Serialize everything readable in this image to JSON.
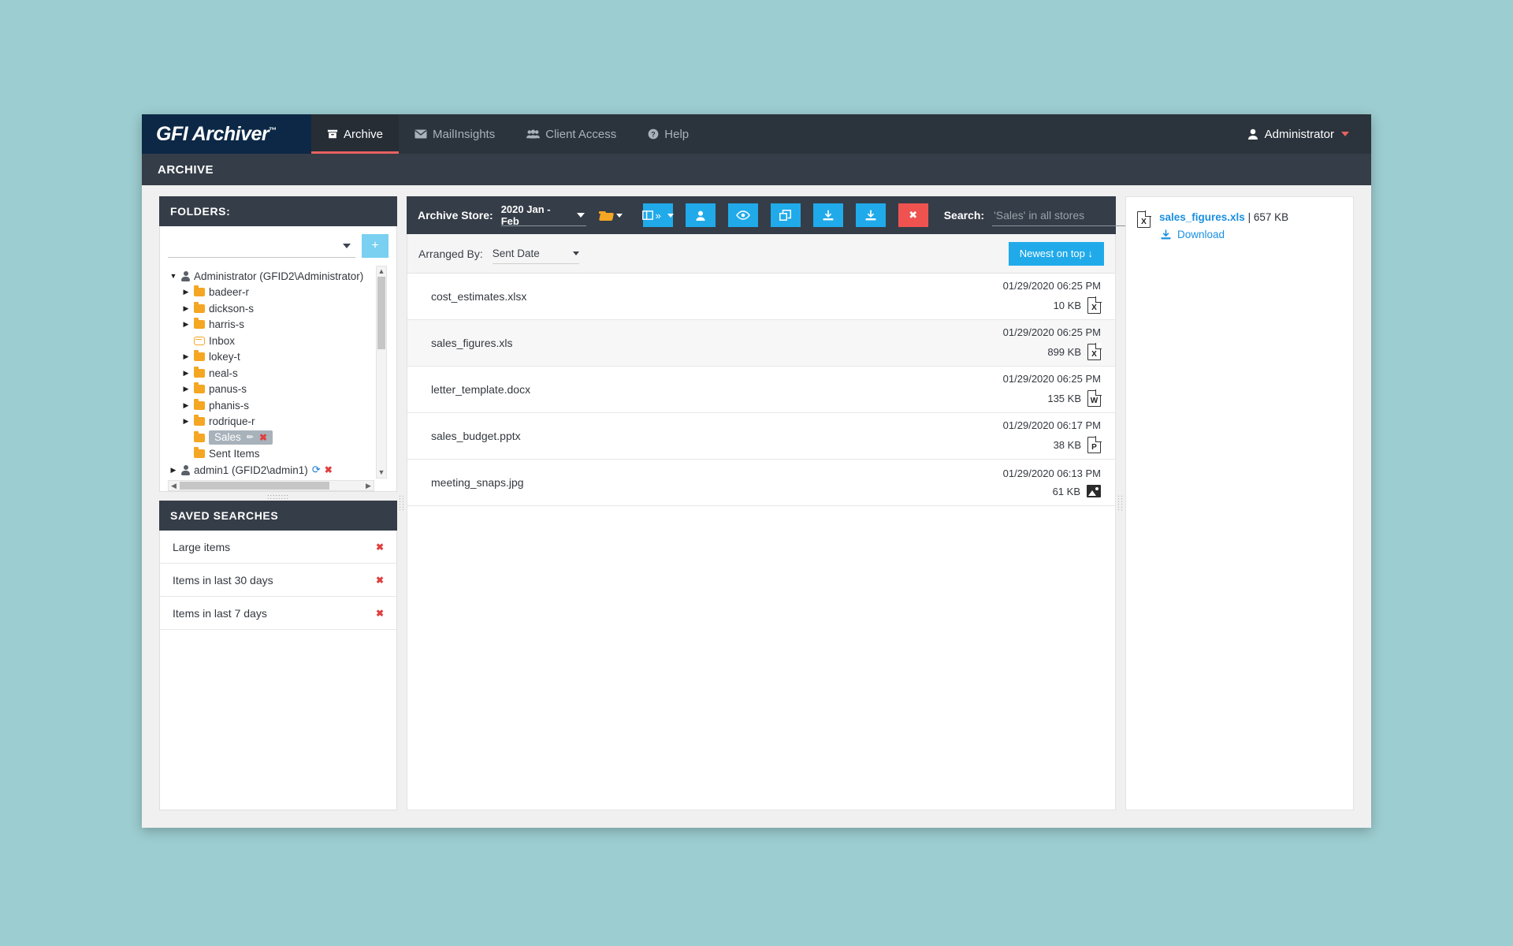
{
  "app": {
    "logo_primary": "GFI",
    "logo_secondary": "Archiver",
    "logo_tm": "™"
  },
  "topnav": {
    "items": [
      {
        "label": "Archive",
        "icon": "archive-box-icon",
        "active": true
      },
      {
        "label": "MailInsights",
        "icon": "envelope-icon",
        "active": false
      },
      {
        "label": "Client Access",
        "icon": "users-icon",
        "active": false
      },
      {
        "label": "Help",
        "icon": "question-circle-icon",
        "active": false
      }
    ],
    "user": {
      "label": "Administrator",
      "icon": "user-icon"
    }
  },
  "breadcrumb": {
    "title": "ARCHIVE"
  },
  "folders_panel": {
    "header": "FOLDERS:",
    "select_value": "",
    "add_button_label": "+",
    "tree": [
      {
        "label": "Administrator (GFID2\\Administrator)",
        "kind": "user",
        "depth": 0,
        "expanded": true,
        "toggle": "▼"
      },
      {
        "label": "badeer-r",
        "kind": "folder",
        "depth": 1,
        "toggle": "▶"
      },
      {
        "label": "dickson-s",
        "kind": "folder",
        "depth": 1,
        "toggle": "▶"
      },
      {
        "label": "harris-s",
        "kind": "folder",
        "depth": 1,
        "toggle": "▶"
      },
      {
        "label": "Inbox",
        "kind": "inbox",
        "depth": 1,
        "toggle": ""
      },
      {
        "label": "lokey-t",
        "kind": "folder",
        "depth": 1,
        "toggle": "▶"
      },
      {
        "label": "neal-s",
        "kind": "folder",
        "depth": 1,
        "toggle": "▶"
      },
      {
        "label": "panus-s",
        "kind": "folder",
        "depth": 1,
        "toggle": "▶"
      },
      {
        "label": "phanis-s",
        "kind": "folder",
        "depth": 1,
        "toggle": "▶"
      },
      {
        "label": "rodrique-r",
        "kind": "folder",
        "depth": 1,
        "toggle": "▶"
      },
      {
        "label": "Sales",
        "kind": "folder",
        "depth": 1,
        "toggle": "",
        "selected": true
      },
      {
        "label": "Sent Items",
        "kind": "folder",
        "depth": 1,
        "toggle": ""
      },
      {
        "label": "admin1 (GFID2\\admin1)",
        "kind": "user",
        "depth": 0,
        "toggle": "▶"
      }
    ],
    "selected_actions": {
      "edit": "✏",
      "delete": "✖"
    },
    "account_actions": {
      "refresh": "⟳",
      "delete": "✖"
    }
  },
  "saved_searches": {
    "header": "SAVED SEARCHES",
    "items": [
      {
        "label": "Large items",
        "delete": "✖"
      },
      {
        "label": "Items in last 30 days",
        "delete": "✖"
      },
      {
        "label": "Items in last 7 days",
        "delete": "✖"
      }
    ]
  },
  "toolbar": {
    "store_label": "Archive Store:",
    "store_value": "2020 Jan - Feb",
    "folder_picker_icon": "open-folder-icon",
    "buttons": [
      {
        "name": "view-layout-button",
        "icon": "columns-icon",
        "glyph": "»",
        "has_caret": true,
        "style": "primary"
      },
      {
        "name": "assign-user-button",
        "icon": "user-icon",
        "glyph": "",
        "has_caret": false,
        "style": "primary"
      },
      {
        "name": "mark-read-button",
        "icon": "eye-icon",
        "glyph": "",
        "has_caret": false,
        "style": "primary"
      },
      {
        "name": "copy-button",
        "icon": "copy-icon",
        "glyph": "",
        "has_caret": false,
        "style": "primary"
      },
      {
        "name": "download-button",
        "icon": "download-icon",
        "glyph": "",
        "has_caret": false,
        "style": "primary"
      },
      {
        "name": "export-button",
        "icon": "download-icon",
        "glyph": "",
        "has_caret": false,
        "style": "primary"
      },
      {
        "name": "delete-button",
        "icon": "close-icon",
        "glyph": "✖",
        "has_caret": false,
        "style": "danger"
      }
    ],
    "search_label": "Search:",
    "search_value": "",
    "search_placeholder": "'Sales' in all stores",
    "search_button_icon": "search-icon",
    "search_options_icon": "chevron-down-icon"
  },
  "arrange_bar": {
    "label": "Arranged By:",
    "value": "Sent Date",
    "sort_button": "Newest on top ↓"
  },
  "file_list": {
    "rows": [
      {
        "name": "cost_estimates.xlsx",
        "date": "01/29/2020 06:25 PM",
        "size": "10 KB",
        "type": "excel",
        "letter": "X"
      },
      {
        "name": "sales_figures.xls",
        "date": "01/29/2020 06:25 PM",
        "size": "899 KB",
        "type": "excel",
        "letter": "X"
      },
      {
        "name": "letter_template.docx",
        "date": "01/29/2020 06:25 PM",
        "size": "135 KB",
        "type": "word",
        "letter": "W"
      },
      {
        "name": "sales_budget.pptx",
        "date": "01/29/2020 06:17 PM",
        "size": "38 KB",
        "type": "powerpoint",
        "letter": "P"
      },
      {
        "name": "meeting_snaps.jpg",
        "date": "01/29/2020 06:13 PM",
        "size": "61 KB",
        "type": "image",
        "letter": ""
      }
    ]
  },
  "preview": {
    "attachment_name": "sales_figures.xls",
    "attachment_size": "| 657 KB",
    "download_label": "Download",
    "icon_letter": "X"
  },
  "colors": {
    "accent": "#20aaea",
    "danger": "#ef5350",
    "header_dark": "#353d48",
    "nav_dark": "#2b333c",
    "logo_navy": "#0c2846",
    "folder_orange": "#f5a623",
    "link_blue": "#1a8fe0",
    "page_bg": "#9ccdd0",
    "active_underline": "#e8625f"
  }
}
